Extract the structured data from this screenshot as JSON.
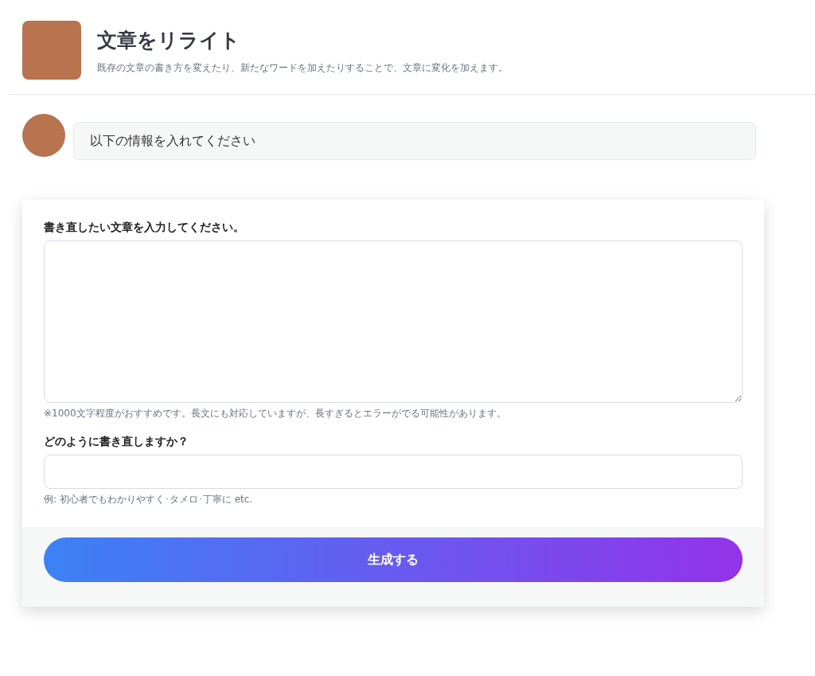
{
  "header": {
    "title": "文章をリライト",
    "description": "既存の文章の書き方を変えたり、新たなワードを加えたりすることで、文章に変化を加えます。"
  },
  "chat": {
    "message": "以下の情報を入れてください"
  },
  "form": {
    "fields": [
      {
        "kind": "textarea",
        "label": "書き直したい文章を入力してください。",
        "hint": "※1000文字程度がおすすめです。長文にも対応していますが、長すぎるとエラーがでる可能性があります。"
      },
      {
        "kind": "input",
        "label": "どのように書き直しますか？",
        "hint": "例: 初心者でもわかりやすく･タメロ･丁寧に etc."
      }
    ],
    "submit": "生成する"
  }
}
